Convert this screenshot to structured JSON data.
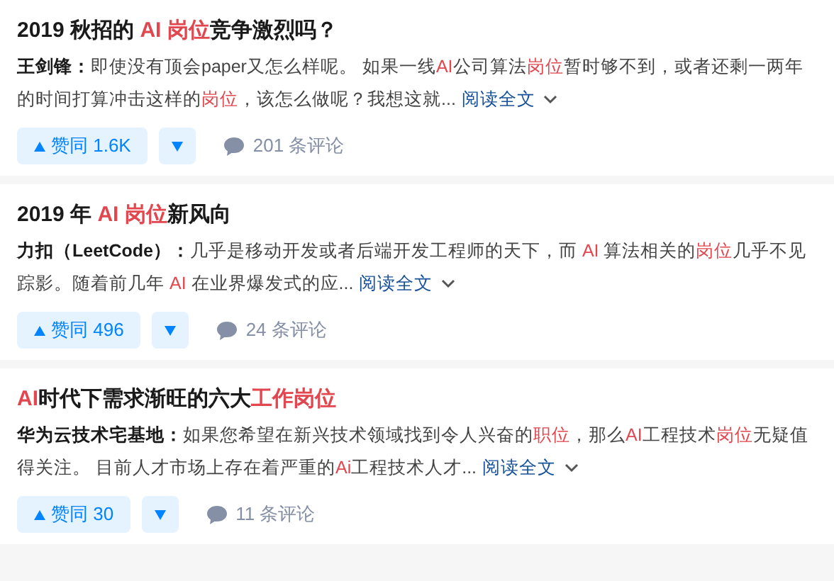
{
  "answers": [
    {
      "title": [
        {
          "text": "2019 秋招的 ",
          "highlight": false
        },
        {
          "text": "AI 岗位",
          "highlight": true
        },
        {
          "text": "竞争激烈吗？",
          "highlight": false
        }
      ],
      "author": "王剑锋：",
      "excerpt": [
        {
          "text": "即使没有顶会paper又怎么样呢。 如果一线",
          "highlight": false
        },
        {
          "text": "AI",
          "highlight": true
        },
        {
          "text": "公司算法",
          "highlight": false
        },
        {
          "text": "岗位",
          "highlight": true
        },
        {
          "text": "暂时够不到，或者还剩一两年的时间打算冲击这样的",
          "highlight": false
        },
        {
          "text": "岗位",
          "highlight": true
        },
        {
          "text": "，该怎么做呢？我想这就...",
          "highlight": false
        }
      ],
      "read_more": "阅读全文",
      "upvote": "赞同 1.6K",
      "comments": "201 条评论"
    },
    {
      "title": [
        {
          "text": "2019 年 ",
          "highlight": false
        },
        {
          "text": "AI 岗位",
          "highlight": true
        },
        {
          "text": "新风向",
          "highlight": false
        }
      ],
      "author": "力扣（LeetCode）：",
      "excerpt": [
        {
          "text": "几乎是移动开发或者后端开发工程师的天下，而 ",
          "highlight": false
        },
        {
          "text": "AI",
          "highlight": true
        },
        {
          "text": " 算法相关的",
          "highlight": false
        },
        {
          "text": "岗位",
          "highlight": true
        },
        {
          "text": "几乎不见踪影。随着前几年 ",
          "highlight": false
        },
        {
          "text": "AI",
          "highlight": true
        },
        {
          "text": " 在业界爆发式的应...",
          "highlight": false
        }
      ],
      "read_more": "阅读全文",
      "upvote": "赞同 496",
      "comments": "24 条评论"
    },
    {
      "title": [
        {
          "text": "AI",
          "highlight": true
        },
        {
          "text": "时代下需求渐旺的六大",
          "highlight": false
        },
        {
          "text": "工作岗位",
          "highlight": true
        }
      ],
      "author": "华为云技术宅基地：",
      "excerpt": [
        {
          "text": "如果您希望在新兴技术领域找到令人兴奋的",
          "highlight": false
        },
        {
          "text": "职位",
          "highlight": true
        },
        {
          "text": "，那么",
          "highlight": false
        },
        {
          "text": "AI",
          "highlight": true
        },
        {
          "text": "工程技术",
          "highlight": false
        },
        {
          "text": "岗位",
          "highlight": true
        },
        {
          "text": "无疑值得关注。 目前人才市场上存在着严重的",
          "highlight": false
        },
        {
          "text": "Ai",
          "highlight": true
        },
        {
          "text": "工程技术人才...",
          "highlight": false
        }
      ],
      "read_more": "阅读全文",
      "upvote": "赞同 30",
      "comments": "11 条评论"
    }
  ]
}
